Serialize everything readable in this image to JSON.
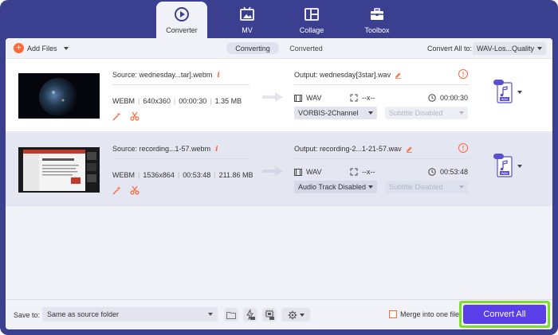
{
  "nav": {
    "tabs": [
      {
        "label": "Converter",
        "icon": "converter-icon",
        "active": true
      },
      {
        "label": "MV",
        "icon": "mv-icon",
        "active": false
      },
      {
        "label": "Collage",
        "icon": "collage-icon",
        "active": false
      },
      {
        "label": "Toolbox",
        "icon": "toolbox-icon",
        "active": false
      }
    ]
  },
  "toolbar": {
    "add_files": "Add Files",
    "tab_converting": "Converting",
    "tab_converted": "Converted",
    "convert_all_to_label": "Convert All to:",
    "convert_all_format": "WAV-Los...Quality"
  },
  "files": [
    {
      "source": "Source: wednesday...tar].webm",
      "format": "WEBM",
      "resolution": "640x360",
      "duration": "00:00:30",
      "size": "1.35 MB",
      "output": "Output: wednesday[3star].wav",
      "out_format": "WAV",
      "out_resolution": "--x--",
      "out_duration": "00:00:30",
      "audio_track": "VORBIS-2Channel",
      "subtitle": "Subtitle Disabled",
      "file_badge": "WAV"
    },
    {
      "source": "Source: recording...1-57.webm",
      "format": "WEBM",
      "resolution": "1536x864",
      "duration": "00:53:48",
      "size": "211.86 MB",
      "output": "Output: recording-2...1-21-57.wav",
      "out_format": "WAV",
      "out_resolution": "--x--",
      "out_duration": "00:53:48",
      "audio_track": "Audio Track Disabled",
      "subtitle": "Subtitle Disabled",
      "file_badge": "WAV"
    }
  ],
  "bottom": {
    "save_to_label": "Save to:",
    "save_path": "Same as source folder",
    "merge_label": "Merge into one file",
    "convert_all_button": "Convert All"
  },
  "colors": {
    "frame": "#3b3f8f",
    "accent_orange": "#ff6a3d",
    "primary_button": "#5a3fe8",
    "highlight_border": "#7ddc2c"
  }
}
